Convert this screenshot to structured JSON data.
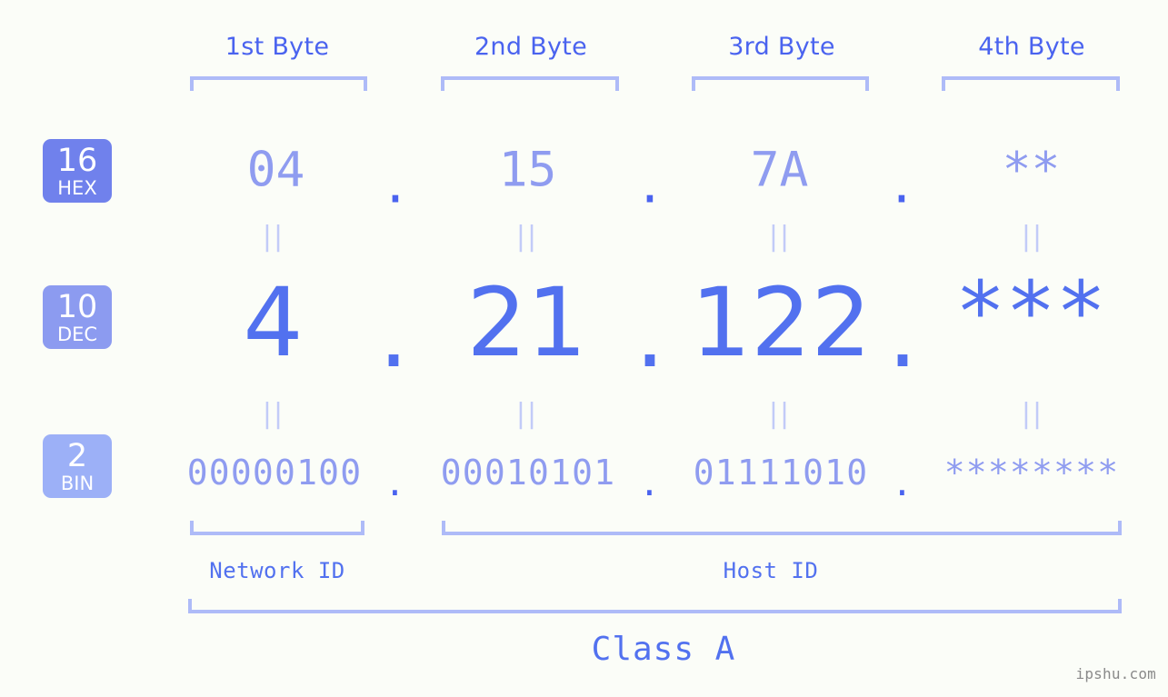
{
  "page": {
    "background_color": "#fbfdf8",
    "accent_color": "#4a63ef",
    "light_accent_color": "#aebbf8",
    "watermark": "ipshu.com"
  },
  "byte_headers": [
    {
      "label": "1st Byte"
    },
    {
      "label": "2nd Byte"
    },
    {
      "label": "3rd Byte"
    },
    {
      "label": "4th Byte"
    }
  ],
  "radix_badges": [
    {
      "number": "16",
      "abbr": "HEX",
      "color": "#7081ec"
    },
    {
      "number": "10",
      "abbr": "DEC",
      "color": "#8c9bf0"
    },
    {
      "number": "2",
      "abbr": "BIN",
      "color": "#9cb0f7"
    }
  ],
  "rows": {
    "hex": {
      "values": [
        "04",
        "15",
        "7A",
        "**"
      ],
      "separator": "."
    },
    "dec": {
      "values": [
        "4",
        "21",
        "122",
        "***"
      ],
      "separator": "."
    },
    "bin": {
      "values": [
        "00000100",
        "00010101",
        "01111010",
        "********"
      ],
      "separator": "."
    }
  },
  "equals_symbol": "||",
  "sections": {
    "network_id": "Network ID",
    "host_id": "Host ID",
    "class": "Class A"
  }
}
